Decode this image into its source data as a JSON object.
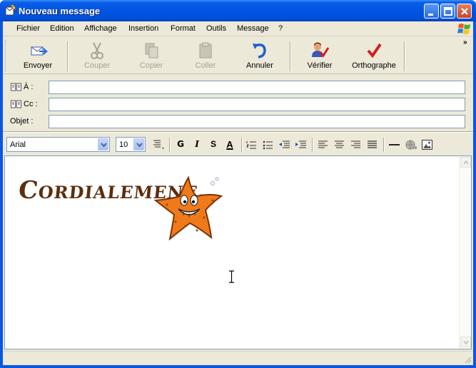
{
  "window": {
    "title": "Nouveau message"
  },
  "menu": [
    "Fichier",
    "Edition",
    "Affichage",
    "Insertion",
    "Format",
    "Outils",
    "Message",
    "?"
  ],
  "toolbar": {
    "send": "Envoyer",
    "cut": "Couper",
    "copy": "Copier",
    "paste": "Coller",
    "undo": "Annuler",
    "check": "Vérifier",
    "spelling": "Orthographe"
  },
  "headers": {
    "to_label": "À :",
    "cc_label": "Cc :",
    "subject_label": "Objet :"
  },
  "format": {
    "font": "Arial",
    "size": "10",
    "bold": "G",
    "italic": "I",
    "underline": "S",
    "font_color": "A"
  },
  "body": {
    "signature": "Cordialement,"
  },
  "colors": {
    "titlebar": "#0054e3",
    "chrome": "#ece9d8",
    "input_border": "#7f9db9",
    "signature": "#5c2e0e",
    "starfish": "#f07a1a"
  }
}
